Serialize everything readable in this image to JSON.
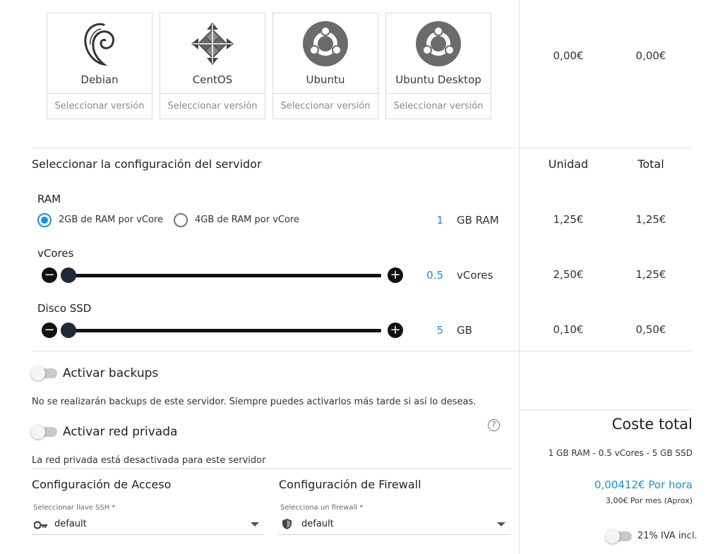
{
  "os_options": [
    {
      "name": "Debian",
      "version_placeholder": "Seleccionar versión",
      "icon": "debian-icon"
    },
    {
      "name": "CentOS",
      "version_placeholder": "Seleccionar versión",
      "icon": "centos-icon"
    },
    {
      "name": "Ubuntu",
      "version_placeholder": "Seleccionar versión",
      "icon": "ubuntu-icon"
    },
    {
      "name": "Ubuntu Desktop",
      "version_placeholder": "Seleccionar versión",
      "icon": "ubuntu-icon"
    }
  ],
  "os_prices": {
    "unit": "0,00€",
    "total": "0,00€"
  },
  "config": {
    "title": "Seleccionar la configuración del servidor",
    "col_unit": "Unidad",
    "col_total": "Total",
    "ram": {
      "label": "RAM",
      "option_1": "2GB de RAM por vCore",
      "option_2": "4GB de RAM por vCore",
      "selected": 1,
      "value": "1",
      "unit": "GB RAM",
      "price_unit": "1,25€",
      "price_total": "1,25€"
    },
    "vcores": {
      "label": "vCores",
      "value": "0.5",
      "unit": "vCores",
      "slider_level": 0,
      "price_unit": "2,50€",
      "price_total": "1,25€"
    },
    "disk": {
      "label": "Disco SSD",
      "value": "5",
      "unit": "GB",
      "slider_level": 0,
      "price_unit": "0,10€",
      "price_total": "0,50€"
    }
  },
  "backups": {
    "label": "Activar backups",
    "enabled": false,
    "note": "No se realizarán backups de este servidor. Siempre puedes activarlos más tarde si así lo deseas."
  },
  "private_network": {
    "label": "Activar red privada",
    "enabled": false,
    "help": "?",
    "note": "La red privada está desactivada para este servidor"
  },
  "access": {
    "title": "Configuración de Acceso",
    "field_label": "Seleccionar llave SSH *",
    "value": "default",
    "icon": "key-icon"
  },
  "firewall": {
    "title": "Configuración de Firewall",
    "field_label": "Selecciona un firewall *",
    "value": "default",
    "icon": "shield-icon"
  },
  "total": {
    "title": "Coste total",
    "summary": "1 GB RAM - 0.5 vCores - 5 GB SSD",
    "hourly": "0,00412€ Por hora",
    "monthly": "3,00€ Por mes (Aprox)",
    "iva_label": "21% IVA incl.",
    "iva_enabled": false
  },
  "colors": {
    "accent": "#1a8fe3",
    "border": "#d9d9d9",
    "knob": "#1e2a3a"
  }
}
